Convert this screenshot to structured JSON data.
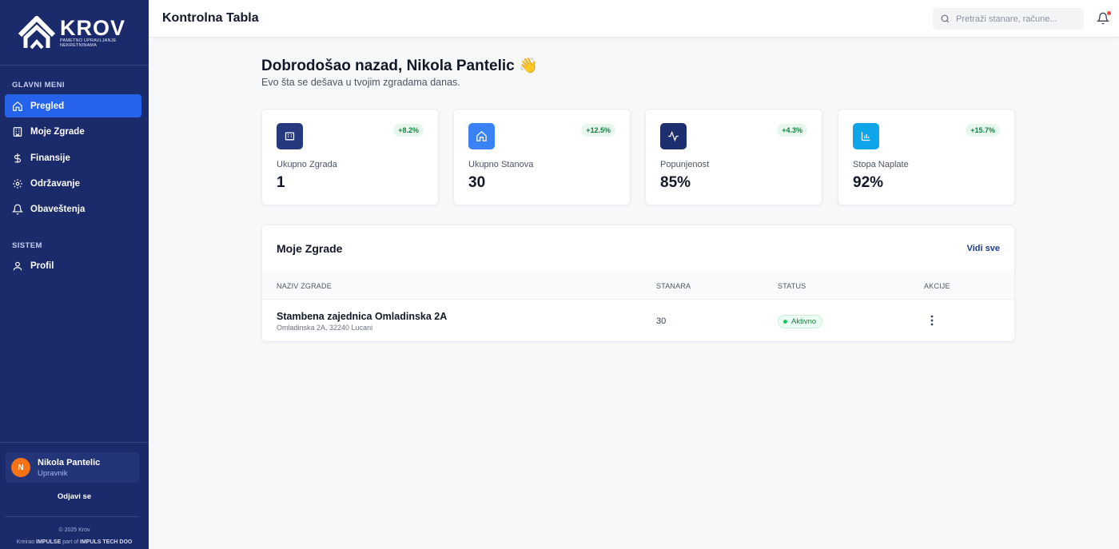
{
  "brand": {
    "name": "KROV",
    "tagline": "Pametno upravljanje nekretninama"
  },
  "sidebar": {
    "sections": {
      "main": "GLAVNI MENI",
      "system": "SISTEM"
    },
    "items": [
      {
        "label": "Pregled",
        "icon": "home-icon",
        "active": true
      },
      {
        "label": "Moje Zgrade",
        "icon": "building-icon"
      },
      {
        "label": "Finansije",
        "icon": "dollar-icon"
      },
      {
        "label": "Održavanje",
        "icon": "gear-icon"
      },
      {
        "label": "Obaveštenja",
        "icon": "bell-icon"
      }
    ],
    "system_items": [
      {
        "label": "Profil",
        "icon": "user-icon"
      }
    ],
    "user": {
      "initial": "N",
      "name": "Nikola Pantelic",
      "role": "Upravnik"
    },
    "logout": "Odjavi se",
    "copyright": "© 2025 Krov",
    "credits": {
      "prefix": "Kreirao",
      "company": "IMPULSE",
      "middle": "part of",
      "parent": "IMPULS TECH DOO"
    }
  },
  "header": {
    "title": "Kontrolna Tabla",
    "search_placeholder": "Pretraži stanare, račune..."
  },
  "welcome": {
    "title": "Dobrodošao nazad, Nikola Pantelic 👋",
    "subtitle": "Evo šta se dešava u tvojim zgradama danas."
  },
  "stats": [
    {
      "label": "Ukupno Zgrada",
      "value": "1",
      "change": "+8.2%",
      "icon": "building-icon",
      "color": "#27397e"
    },
    {
      "label": "Ukupno Stanova",
      "value": "30",
      "change": "+12.5%",
      "icon": "home-icon",
      "color": "#3b82f6"
    },
    {
      "label": "Popunjenost",
      "value": "85%",
      "change": "+4.3%",
      "icon": "activity-icon",
      "color": "#1e2f6f"
    },
    {
      "label": "Stopa Naplate",
      "value": "92%",
      "change": "+15.7%",
      "icon": "bar-chart-icon",
      "color": "#0ea5e9"
    }
  ],
  "buildings": {
    "title": "Moje Zgrade",
    "view_all": "Vidi sve",
    "columns": [
      "NAZIV ZGRADE",
      "STANARA",
      "STATUS",
      "AKCIJE"
    ],
    "rows": [
      {
        "name": "Stambena zajednica Omladinska 2A",
        "address": "Omladinska 2A, 32240 Lucani",
        "residents": "30",
        "status": "Aktivno"
      }
    ]
  }
}
